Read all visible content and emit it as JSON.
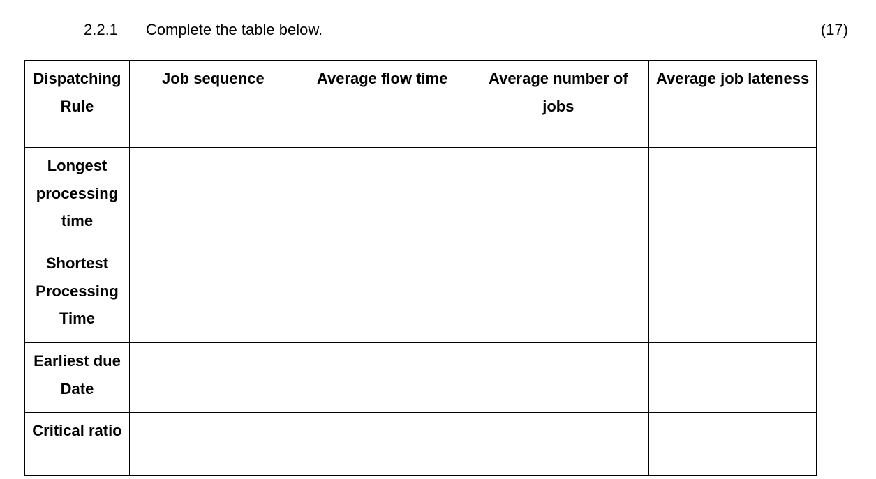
{
  "question": {
    "number": "2.2.1",
    "text": "Complete the table below.",
    "marks": "(17)"
  },
  "table": {
    "headers": {
      "rule": "Dispatching Rule",
      "sequence": "Job sequence",
      "flow": "Average flow time",
      "numjobs": "Average number of jobs",
      "lateness": "Average job lateness"
    },
    "rows": [
      {
        "rule": "Longest processing time",
        "sequence": "",
        "flow": "",
        "numjobs": "",
        "lateness": ""
      },
      {
        "rule": "Shortest Processing Time",
        "sequence": "",
        "flow": "",
        "numjobs": "",
        "lateness": ""
      },
      {
        "rule": "Earliest due Date",
        "sequence": "",
        "flow": "",
        "numjobs": "",
        "lateness": ""
      },
      {
        "rule": "Critical ratio",
        "sequence": "",
        "flow": "",
        "numjobs": "",
        "lateness": ""
      }
    ]
  }
}
